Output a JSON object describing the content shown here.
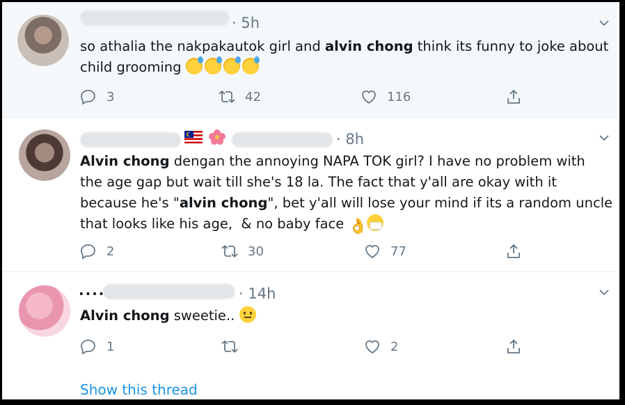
{
  "tweets": [
    {
      "time": "· 5h",
      "text_a": "so athalia the nakpakautok girl and ",
      "bold_1": "alvin chong",
      "text_b": " think its funny to joke about\nchild grooming ",
      "replies": "3",
      "retweets": "42",
      "likes": "116"
    },
    {
      "time": "· 8h",
      "bold_1": "Alvin chong",
      "text_a": " dengan the annoying NAPA TOK girl? I have no problem with\nthe age gap but wait till she's 18 la. The fact that y'all are okay with it\nbecause he's \"",
      "bold_2": "alvin chong",
      "text_b": "\", bet y'all will lose your mind if its a random uncle\nthat looks like his age,  & no baby face ",
      "replies": "2",
      "retweets": "30",
      "likes": "77"
    },
    {
      "name_partial": "....",
      "time": "· 14h",
      "bold_1": "Alvin chong",
      "text_a": " sweetie.. ",
      "replies": "1",
      "retweets": "",
      "likes": "2",
      "thread_link": "Show this thread"
    }
  ],
  "icons": {
    "reply": "reply-icon",
    "retweet": "retweet-icon",
    "like": "heart-icon",
    "share": "share-icon",
    "caret": "chevron-down-icon"
  },
  "colors": {
    "link": "#1b95e0",
    "meta": "#657786",
    "highlight_bg": "#f5f8fa"
  }
}
